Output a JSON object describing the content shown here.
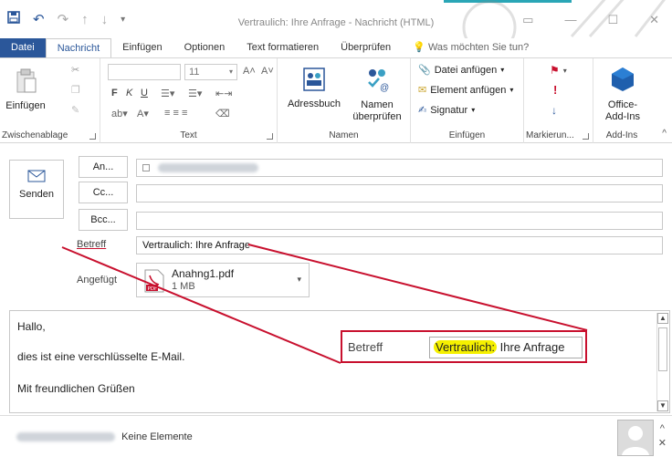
{
  "window": {
    "title": "Vertraulich: Ihre Anfrage - Nachricht (HTML)"
  },
  "ribbon_tabs": [
    {
      "label": "Datei"
    },
    {
      "label": "Nachricht"
    },
    {
      "label": "Einfügen"
    },
    {
      "label": "Optionen"
    },
    {
      "label": "Text formatieren"
    },
    {
      "label": "Überprüfen"
    },
    {
      "label": "Was möchten Sie tun?"
    }
  ],
  "ribbon": {
    "clipboard": {
      "paste_label": "Einfügen",
      "group_label": "Zwischenablage"
    },
    "text": {
      "font_size": "11",
      "group_label": "Text",
      "bold": "F",
      "italic": "K",
      "underline": "U"
    },
    "names": {
      "address_book": "Adressbuch",
      "check_names_1": "Namen",
      "check_names_2": "überprüfen",
      "group_label": "Namen"
    },
    "insert": {
      "attach_file": "Datei anfügen",
      "attach_item": "Element anfügen",
      "signature": "Signatur",
      "group_label": "Einfügen"
    },
    "tags": {
      "group_label": "Markierun..."
    },
    "addins": {
      "office_1": "Office-",
      "office_2": "Add-Ins",
      "group_label": "Add-Ins"
    }
  },
  "compose": {
    "send_label": "Senden",
    "to_label": "An...",
    "cc_label": "Cc...",
    "bcc_label": "Bcc...",
    "subject_label": "Betreff",
    "subject_value": "Vertraulich: Ihre Anfrage",
    "attached_label": "Angefügt",
    "attachment": {
      "name": "Anahng1.pdf",
      "size": "1 MB",
      "type_label": "PDF"
    },
    "body_lines": [
      "Hallo,",
      "dies ist eine verschlüsselte E-Mail.",
      "Mit freundlichen Grüßen"
    ]
  },
  "callout": {
    "label": "Betreff",
    "highlight": "Vertraulich:",
    "rest": " Ihre Anfrage"
  },
  "footer": {
    "status": "Keine Elemente"
  },
  "colors": {
    "accent": "#2b579a",
    "callout_border": "#c8102e",
    "highlight": "#f5f000"
  }
}
